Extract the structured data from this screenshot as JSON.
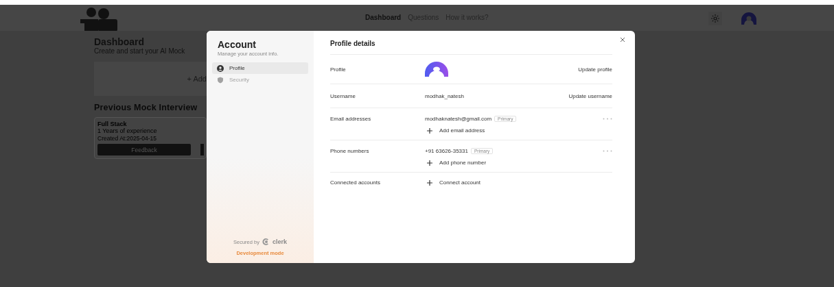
{
  "nav": {
    "links": [
      {
        "label": "Dashboard",
        "selected": true
      },
      {
        "label": "Questions",
        "selected": false
      },
      {
        "label": "How it works?",
        "selected": false
      }
    ]
  },
  "dashboard": {
    "title": "Dashboard",
    "subtitle": "Create and start your AI Mock",
    "add_label": "+ Add",
    "previous_title": "Previous Mock Interview",
    "card": {
      "title": "Full Stack",
      "experience": "1 Years of experience",
      "created": "Created At:2025-04-15",
      "button": "Feedback"
    }
  },
  "account": {
    "title": "Account",
    "subtitle": "Manage your account info.",
    "menu": [
      {
        "label": "Profile",
        "selected": true
      },
      {
        "label": "Security",
        "selected": false
      }
    ],
    "secured_by": "Secured by",
    "brand": "clerk",
    "mode": "Development mode"
  },
  "profile": {
    "title": "Profile details",
    "rows": [
      {
        "kind": "avatar",
        "label": "Profile",
        "action": "Update profile"
      },
      {
        "kind": "text",
        "label": "Username",
        "value": "modhak_natesh",
        "action": "Update username"
      },
      {
        "kind": "list",
        "label": "Email addresses",
        "value": "modhaknatesh@gmail.com",
        "badge": "Primary",
        "add": "Add email address"
      },
      {
        "kind": "list",
        "label": "Phone numbers",
        "value": "+91 63626-35331",
        "badge": "Primary",
        "add": "Add phone number"
      },
      {
        "kind": "connect",
        "label": "Connected accounts",
        "add": "Connect account"
      }
    ]
  }
}
